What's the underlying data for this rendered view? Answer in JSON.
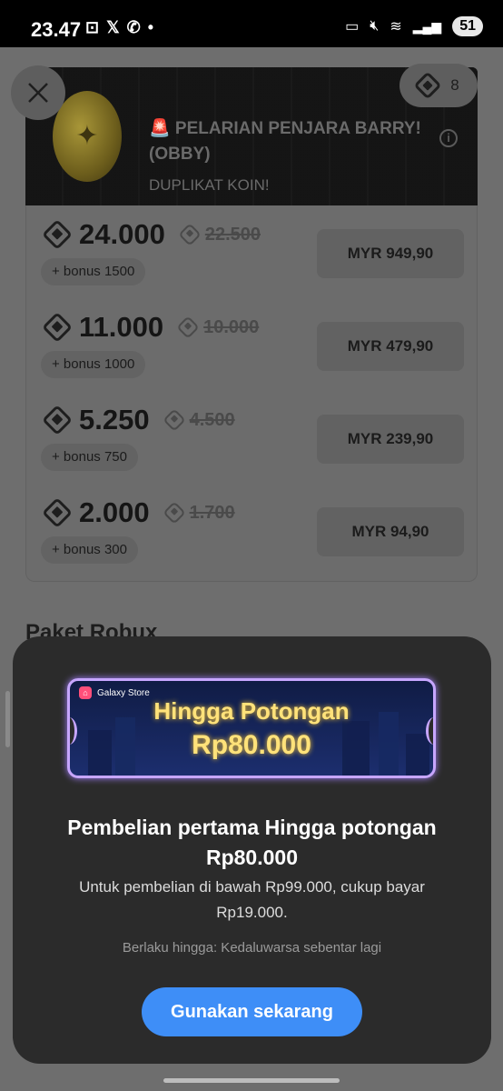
{
  "status_bar": {
    "time": "23.47",
    "left_icons": [
      "screenshot-icon",
      "x-icon",
      "whatsapp-icon",
      "dot"
    ],
    "right_icons": [
      "bed-icon",
      "mute-icon",
      "wifi-icon",
      "signal-icon"
    ],
    "battery": "51"
  },
  "game": {
    "title": "🚨 PELARIAN PENJARA BARRY! (OBBY)",
    "subtitle": "DUPLIKAT KOIN!",
    "robux_balance": "8"
  },
  "packs": [
    {
      "amount": "24.000",
      "old_amount": "22.500",
      "bonus": "+ bonus 1500",
      "price": "MYR 949,90"
    },
    {
      "amount": "11.000",
      "old_amount": "10.000",
      "bonus": "+ bonus 1000",
      "price": "MYR 479,90"
    },
    {
      "amount": "5.250",
      "old_amount": "4.500",
      "bonus": "+ bonus 750",
      "price": "MYR 239,90"
    },
    {
      "amount": "2.000",
      "old_amount": "1.700",
      "bonus": "+ bonus 300",
      "price": "MYR 94,90"
    }
  ],
  "background_section_title": "Paket Robux",
  "promo": {
    "store_badge": "Galaxy Store",
    "banner_line1": "Hingga Potongan",
    "banner_line2": "Rp80.000",
    "title": "Pembelian pertama Hingga potongan Rp80.000",
    "description": "Untuk pembelian di bawah Rp99.000, cukup bayar Rp19.000.",
    "validity": "Berlaku hingga: Kedaluwarsa sebentar lagi",
    "cta_label": "Gunakan sekarang"
  },
  "colors": {
    "accent": "#3e8ef7",
    "sheet_bg": "#2b2b2b",
    "banner_text": "#ffe27a"
  }
}
